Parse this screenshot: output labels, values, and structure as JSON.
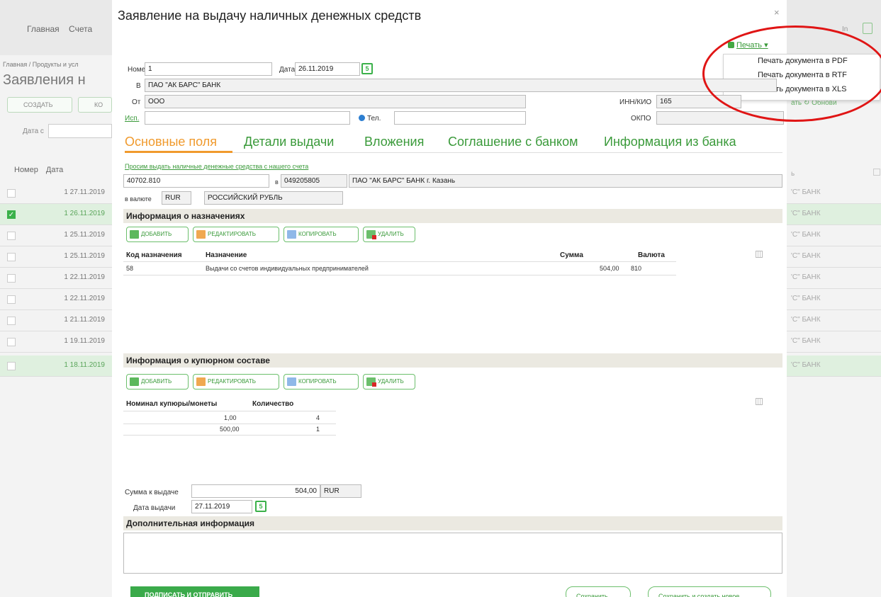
{
  "background": {
    "nav": [
      "Главная",
      "Счета"
    ],
    "right_top_text": "In",
    "breadcrumb": "Главная / Продукты и усл",
    "heading": "Заявления н",
    "create_button": "СОЗДАТЬ",
    "second_button": "КО",
    "date_from_label": "Дата с",
    "columns": [
      "Номер",
      "Дата"
    ],
    "rows": [
      "1 27.11.2019",
      "1 26.11.2019",
      "1 25.11.2019",
      "1 25.11.2019",
      "1 22.11.2019",
      "1 22.11.2019",
      "1 21.11.2019",
      "1 19.11.2019",
      "1 18.11.2019"
    ],
    "right_header": "ь",
    "right_cells": [
      "'С\" БАНК",
      "'С\" БАНК",
      "'С\" БАНК",
      "'С\" БАНК",
      "'С\" БАНК",
      "'С\" БАНК",
      "'С\" БАНК",
      "'С\" БАНК",
      "'С\" БАНК"
    ],
    "right_link": "ать  ↻ Обнови"
  },
  "modal": {
    "title": "Заявление на выдачу наличных денежных средств",
    "close": "×",
    "print_link": "Печать",
    "print_menu": [
      "Печать документа в PDF",
      "Печать документа в RTF",
      "Печать документа в XLS"
    ],
    "header_fields": {
      "number_label": "Номер",
      "number_value": "1",
      "date_label": "Дата",
      "date_value": "26.11.2019",
      "to_label": "В",
      "to_value": "ПАО \"АК БАРС\" БАНК",
      "from_label": "От",
      "from_value": "ООО",
      "inn_label": "ИНН/КИО",
      "inn_value": "165",
      "exec_label": "Исп.",
      "phone_label": "Тел.",
      "okpo_label": "ОКПО"
    },
    "tabs": [
      "Основные поля",
      "Детали выдачи",
      "Вложения",
      "Соглашение с банком",
      "Информация из банка"
    ],
    "request_link": "Просим выдать наличные денежные средства с нашего счета",
    "account": "40702.810",
    "bik_label": "в",
    "bik": "049205805",
    "bank_name": "ПАО \"АК БАРС\" БАНК г. Казань",
    "currency_label": "в валюте",
    "currency_code": "RUR",
    "currency_name": "РОССИЙСКИЙ РУБЛЬ",
    "purposes_section": "Информация о назначениях",
    "buttons": [
      "ДОБАВИТЬ",
      "РЕДАКТИРОВАТЬ",
      "КОПИРОВАТЬ",
      "УДАЛИТЬ"
    ],
    "purposes_table": {
      "headers": [
        "Код назначения",
        "Назначение",
        "Сумма",
        "Валюта"
      ],
      "rows": [
        {
          "code": "58",
          "purpose": "Выдачи со счетов индивидуальных предпринимателей",
          "amount": "504,00",
          "currency": "810"
        }
      ]
    },
    "denominations_section": "Информация о купюрном составе",
    "denominations_table": {
      "headers": [
        "Номинал купюры/монеты",
        "Количество"
      ],
      "rows": [
        {
          "nominal": "1,00",
          "count": "4"
        },
        {
          "nominal": "500,00",
          "count": "1"
        }
      ]
    },
    "total_label": "Сумма к выдаче",
    "total_value": "504,00",
    "total_currency": "RUR",
    "issue_date_label": "Дата выдачи",
    "issue_date_value": "27.11.2019",
    "additional_section": "Дополнительная информация",
    "sign_button": "ПОДПИСАТЬ И ОТПРАВИТЬ",
    "save_button": "Сохранить",
    "save_new_button": "Сохранить и создать новое"
  },
  "colors": {
    "accent_green": "#3bb14a",
    "active_tab": "#f09a2d",
    "annotation_red": "#e01515"
  }
}
